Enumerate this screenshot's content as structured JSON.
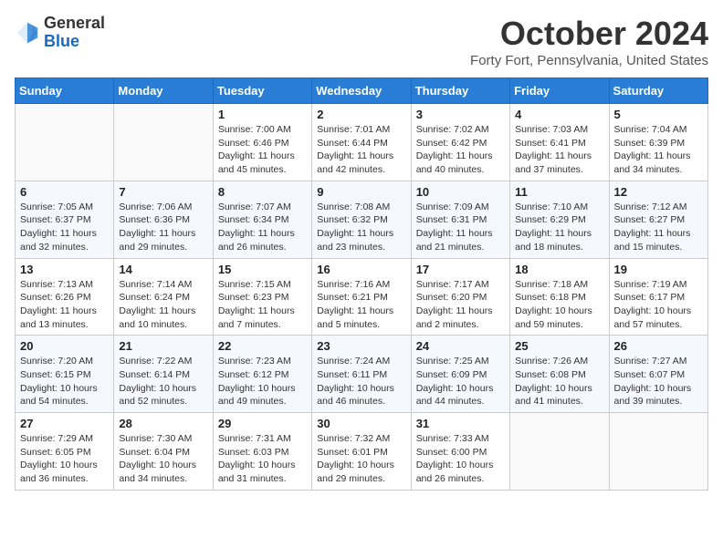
{
  "header": {
    "logo_general": "General",
    "logo_blue": "Blue",
    "month_title": "October 2024",
    "location": "Forty Fort, Pennsylvania, United States"
  },
  "days_of_week": [
    "Sunday",
    "Monday",
    "Tuesday",
    "Wednesday",
    "Thursday",
    "Friday",
    "Saturday"
  ],
  "weeks": [
    [
      {
        "day": "",
        "info": ""
      },
      {
        "day": "",
        "info": ""
      },
      {
        "day": "1",
        "info": "Sunrise: 7:00 AM\nSunset: 6:46 PM\nDaylight: 11 hours and 45 minutes."
      },
      {
        "day": "2",
        "info": "Sunrise: 7:01 AM\nSunset: 6:44 PM\nDaylight: 11 hours and 42 minutes."
      },
      {
        "day": "3",
        "info": "Sunrise: 7:02 AM\nSunset: 6:42 PM\nDaylight: 11 hours and 40 minutes."
      },
      {
        "day": "4",
        "info": "Sunrise: 7:03 AM\nSunset: 6:41 PM\nDaylight: 11 hours and 37 minutes."
      },
      {
        "day": "5",
        "info": "Sunrise: 7:04 AM\nSunset: 6:39 PM\nDaylight: 11 hours and 34 minutes."
      }
    ],
    [
      {
        "day": "6",
        "info": "Sunrise: 7:05 AM\nSunset: 6:37 PM\nDaylight: 11 hours and 32 minutes."
      },
      {
        "day": "7",
        "info": "Sunrise: 7:06 AM\nSunset: 6:36 PM\nDaylight: 11 hours and 29 minutes."
      },
      {
        "day": "8",
        "info": "Sunrise: 7:07 AM\nSunset: 6:34 PM\nDaylight: 11 hours and 26 minutes."
      },
      {
        "day": "9",
        "info": "Sunrise: 7:08 AM\nSunset: 6:32 PM\nDaylight: 11 hours and 23 minutes."
      },
      {
        "day": "10",
        "info": "Sunrise: 7:09 AM\nSunset: 6:31 PM\nDaylight: 11 hours and 21 minutes."
      },
      {
        "day": "11",
        "info": "Sunrise: 7:10 AM\nSunset: 6:29 PM\nDaylight: 11 hours and 18 minutes."
      },
      {
        "day": "12",
        "info": "Sunrise: 7:12 AM\nSunset: 6:27 PM\nDaylight: 11 hours and 15 minutes."
      }
    ],
    [
      {
        "day": "13",
        "info": "Sunrise: 7:13 AM\nSunset: 6:26 PM\nDaylight: 11 hours and 13 minutes."
      },
      {
        "day": "14",
        "info": "Sunrise: 7:14 AM\nSunset: 6:24 PM\nDaylight: 11 hours and 10 minutes."
      },
      {
        "day": "15",
        "info": "Sunrise: 7:15 AM\nSunset: 6:23 PM\nDaylight: 11 hours and 7 minutes."
      },
      {
        "day": "16",
        "info": "Sunrise: 7:16 AM\nSunset: 6:21 PM\nDaylight: 11 hours and 5 minutes."
      },
      {
        "day": "17",
        "info": "Sunrise: 7:17 AM\nSunset: 6:20 PM\nDaylight: 11 hours and 2 minutes."
      },
      {
        "day": "18",
        "info": "Sunrise: 7:18 AM\nSunset: 6:18 PM\nDaylight: 10 hours and 59 minutes."
      },
      {
        "day": "19",
        "info": "Sunrise: 7:19 AM\nSunset: 6:17 PM\nDaylight: 10 hours and 57 minutes."
      }
    ],
    [
      {
        "day": "20",
        "info": "Sunrise: 7:20 AM\nSunset: 6:15 PM\nDaylight: 10 hours and 54 minutes."
      },
      {
        "day": "21",
        "info": "Sunrise: 7:22 AM\nSunset: 6:14 PM\nDaylight: 10 hours and 52 minutes."
      },
      {
        "day": "22",
        "info": "Sunrise: 7:23 AM\nSunset: 6:12 PM\nDaylight: 10 hours and 49 minutes."
      },
      {
        "day": "23",
        "info": "Sunrise: 7:24 AM\nSunset: 6:11 PM\nDaylight: 10 hours and 46 minutes."
      },
      {
        "day": "24",
        "info": "Sunrise: 7:25 AM\nSunset: 6:09 PM\nDaylight: 10 hours and 44 minutes."
      },
      {
        "day": "25",
        "info": "Sunrise: 7:26 AM\nSunset: 6:08 PM\nDaylight: 10 hours and 41 minutes."
      },
      {
        "day": "26",
        "info": "Sunrise: 7:27 AM\nSunset: 6:07 PM\nDaylight: 10 hours and 39 minutes."
      }
    ],
    [
      {
        "day": "27",
        "info": "Sunrise: 7:29 AM\nSunset: 6:05 PM\nDaylight: 10 hours and 36 minutes."
      },
      {
        "day": "28",
        "info": "Sunrise: 7:30 AM\nSunset: 6:04 PM\nDaylight: 10 hours and 34 minutes."
      },
      {
        "day": "29",
        "info": "Sunrise: 7:31 AM\nSunset: 6:03 PM\nDaylight: 10 hours and 31 minutes."
      },
      {
        "day": "30",
        "info": "Sunrise: 7:32 AM\nSunset: 6:01 PM\nDaylight: 10 hours and 29 minutes."
      },
      {
        "day": "31",
        "info": "Sunrise: 7:33 AM\nSunset: 6:00 PM\nDaylight: 10 hours and 26 minutes."
      },
      {
        "day": "",
        "info": ""
      },
      {
        "day": "",
        "info": ""
      }
    ]
  ]
}
